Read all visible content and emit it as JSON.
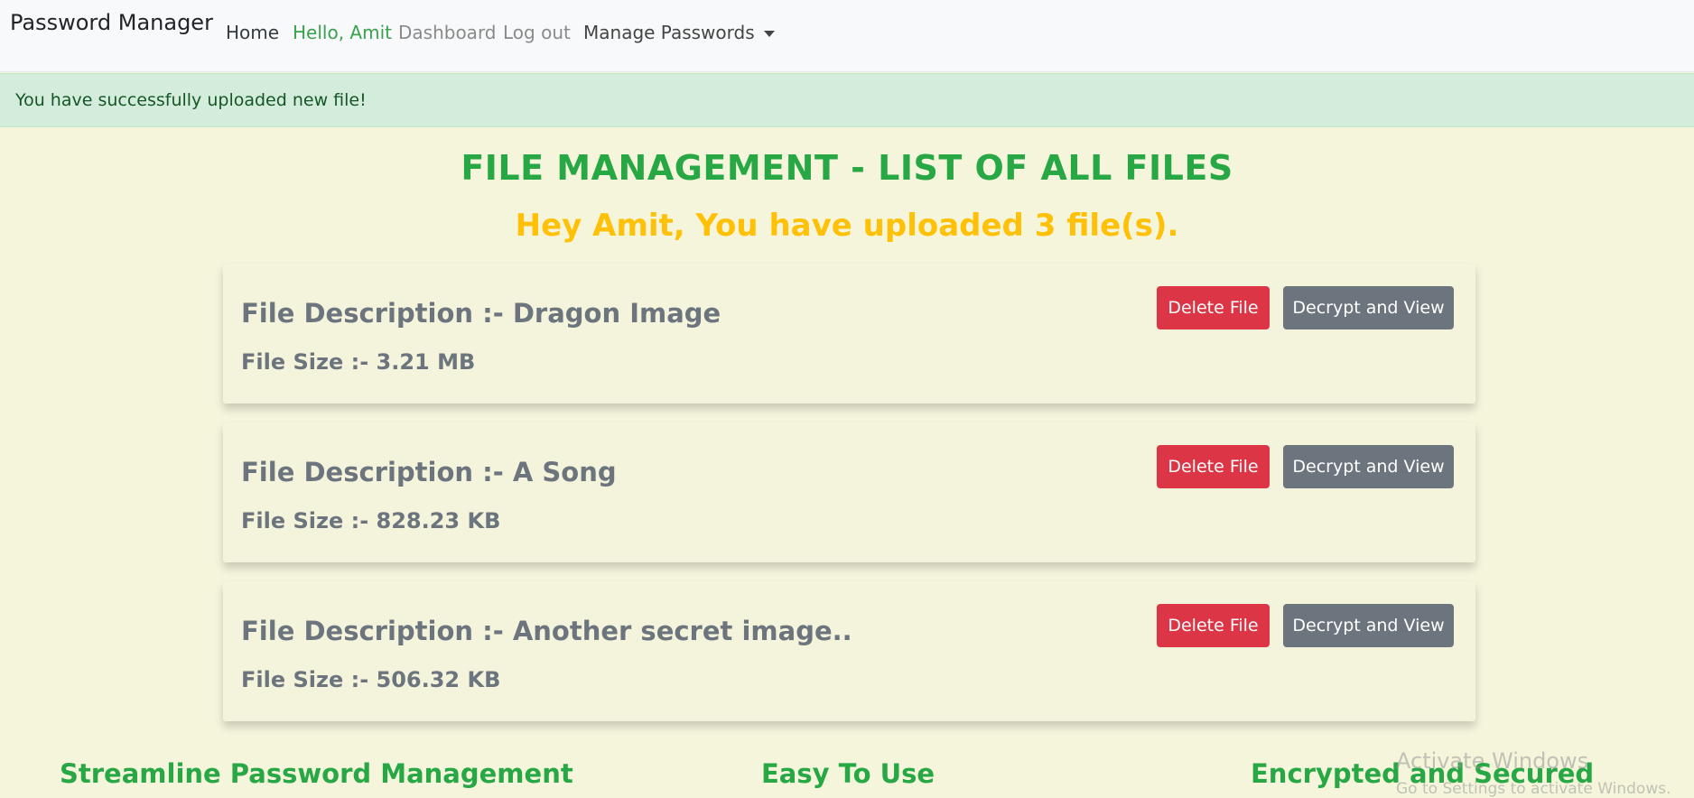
{
  "navbar": {
    "brand": "Password Manager",
    "links": {
      "home": "Home",
      "hello": "Hello, Amit",
      "dashboard": "Dashboard",
      "logout": "Log out",
      "manage": "Manage Passwords"
    }
  },
  "alert": {
    "message": "You have successfully uploaded new file!"
  },
  "page": {
    "title": "FILE MANAGEMENT - LIST OF ALL FILES",
    "subtitle": "Hey Amit, You have uploaded 3 file(s)."
  },
  "files": [
    {
      "description": "File Description :- Dragon Image",
      "size": "File Size :- 3.21 MB",
      "delete_label": "Delete File",
      "view_label": "Decrypt and View"
    },
    {
      "description": "File Description :- A Song",
      "size": "File Size :- 828.23 KB",
      "delete_label": "Delete File",
      "view_label": "Decrypt and View"
    },
    {
      "description": "File Description :- Another secret image..",
      "size": "File Size :- 506.32 KB",
      "delete_label": "Delete File",
      "view_label": "Decrypt and View"
    }
  ],
  "footer": {
    "features": [
      "Streamline Password Management",
      "Easy To Use",
      "Encrypted and Secured"
    ]
  },
  "watermark": {
    "title": "Activate Windows",
    "subtitle": "Go to Settings to activate Windows."
  },
  "colors": {
    "background": "#f5f5dc",
    "success": "#28a745",
    "warning": "#ffc107",
    "danger": "#dc3545",
    "secondary": "#6c757d",
    "alert_bg": "#d4ecdc"
  }
}
